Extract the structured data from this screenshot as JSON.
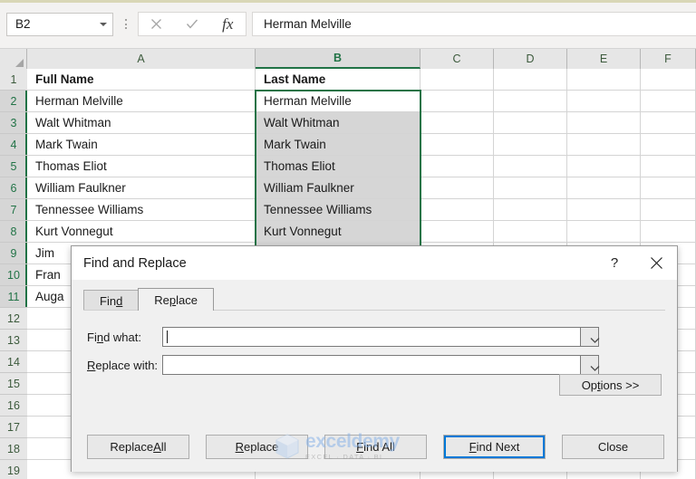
{
  "formula_bar": {
    "name_box_value": "B2",
    "cancel_icon": "close-x-icon",
    "confirm_icon": "checkmark-icon",
    "fx_label": "fx",
    "formula_value": "Herman Melville"
  },
  "grid": {
    "columns": [
      "A",
      "B",
      "C",
      "D",
      "E",
      "F"
    ],
    "selected_column": "B",
    "rows": [
      "1",
      "2",
      "3",
      "4",
      "5",
      "6",
      "7",
      "8",
      "9",
      "10",
      "11",
      "12",
      "13",
      "14",
      "15",
      "16",
      "17",
      "18",
      "19"
    ],
    "selected_rows": [
      "2",
      "3",
      "4",
      "5",
      "6",
      "7",
      "8",
      "9",
      "10",
      "11"
    ],
    "column_a": {
      "header": "Full Name",
      "values": [
        "Herman Melville",
        "Walt Whitman",
        "Mark Twain",
        "Thomas Eliot",
        "William Faulkner",
        "Tennessee Williams",
        "Kurt Vonnegut",
        "Jim",
        "Fran",
        "Auga"
      ]
    },
    "column_b": {
      "header": "Last Name",
      "values": [
        "Herman Melville",
        "Walt Whitman",
        "Mark Twain",
        "Thomas Eliot",
        "William Faulkner",
        "Tennessee Williams",
        "Kurt Vonnegut"
      ]
    },
    "selection_color": "#217346"
  },
  "dialog": {
    "title": "Find and Replace",
    "help_label": "?",
    "close_icon": "close-x-icon",
    "tabs": [
      {
        "label_before": "Fin",
        "label_accel": "d",
        "label_after": "",
        "active": false
      },
      {
        "label_before": "Re",
        "label_accel": "p",
        "label_after": "lace",
        "active": true
      }
    ],
    "fields": [
      {
        "label_before": "Fi",
        "label_accel": "n",
        "label_after": "d what:",
        "value": "",
        "has_caret": true,
        "dropdown_icon": "chevron-down-icon"
      },
      {
        "label_before": "",
        "label_accel": "R",
        "label_after": "eplace with:",
        "value": "",
        "has_caret": false,
        "dropdown_icon": "chevron-down-icon"
      }
    ],
    "options_button": {
      "label_before": "Op",
      "label_accel": "t",
      "label_after": "ions >>"
    },
    "buttons": [
      {
        "label_before": "Replace ",
        "label_accel": "A",
        "label_after": "ll",
        "focused": false
      },
      {
        "label_before": "",
        "label_accel": "R",
        "label_after": "eplace",
        "focused": false
      },
      {
        "label_before": "",
        "label_accel": "F",
        "label_after": "ind All",
        "focused": false
      },
      {
        "label_before": "",
        "label_accel": "F",
        "label_after": "ind Next",
        "focused": true
      },
      {
        "label_before": "Close",
        "label_accel": "",
        "label_after": "",
        "focused": false
      }
    ],
    "focus_color": "#0078d7"
  },
  "watermark": {
    "name": "exceldemy",
    "tagline": "EXCEL · DATA · BI"
  }
}
